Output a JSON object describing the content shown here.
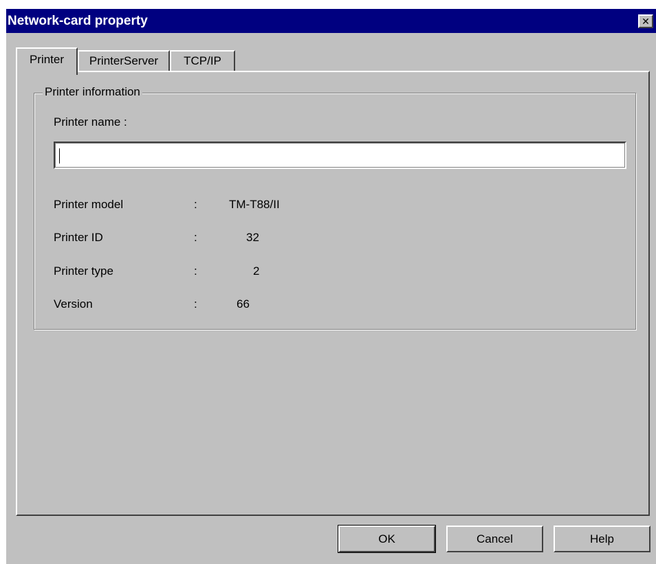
{
  "window": {
    "title": "Network-card property",
    "close_glyph": "✕"
  },
  "tabs": [
    {
      "label": "Printer",
      "active": true
    },
    {
      "label": "PrinterServer",
      "active": false
    },
    {
      "label": "TCP/IP",
      "active": false
    }
  ],
  "printer_info": {
    "group_title": "Printer information",
    "name_label": "Printer name :",
    "name_value": "",
    "separator": ":",
    "rows": [
      {
        "label": "Printer model",
        "value": "TM-T88/II"
      },
      {
        "label": "Printer ID",
        "value": "32"
      },
      {
        "label": "Printer type",
        "value": "2"
      },
      {
        "label": "Version",
        "value": "66"
      }
    ]
  },
  "buttons": {
    "ok": "OK",
    "cancel": "Cancel",
    "help": "Help"
  },
  "colors": {
    "title_bar": "#000080",
    "face": "#c0c0c0"
  }
}
